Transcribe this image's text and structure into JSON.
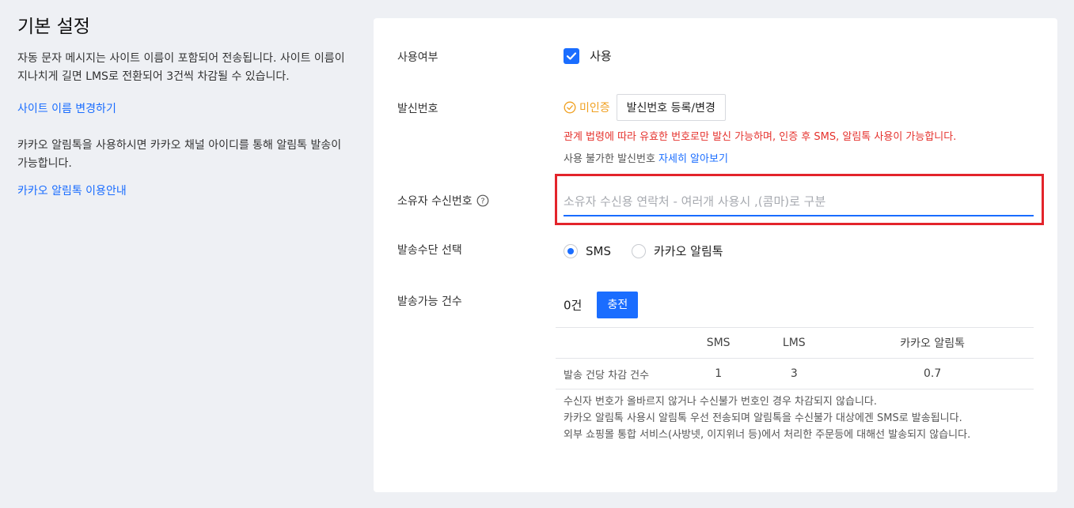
{
  "sidebar": {
    "title": "기본 설정",
    "description1": "자동 문자 메시지는 사이트 이름이 포함되어 전송됩니다. 사이트 이름이 지나치게 길면 LMS로 전환되어 3건씩 차감될 수 있습니다.",
    "link1": "사이트 이름 변경하기",
    "description2": "카카오 알림톡을 사용하시면 카카오 채널 아이디를 통해 알림톡 발송이 가능합니다.",
    "link2": "카카오 알림톡 이용안내"
  },
  "form": {
    "use": {
      "label": "사용여부",
      "checkbox_label": "사용",
      "checked": true
    },
    "sender": {
      "label": "발신번호",
      "status": "미인증",
      "register_button": "발신번호 등록/변경",
      "warning": "관계 법령에 따라 유효한 번호로만 발신 가능하며, 인증 후 SMS, 알림톡 사용이 가능합니다.",
      "note": "사용 불가한 발신번호",
      "note_link": "자세히 알아보기"
    },
    "owner_phone": {
      "label": "소유자 수신번호",
      "placeholder": "소유자 수신용 연락처 - 여러개 사용시 ,(콤마)로 구분",
      "value": ""
    },
    "method": {
      "label": "발송수단 선택",
      "options": [
        "SMS",
        "카카오 알림톡"
      ],
      "selected": "SMS"
    },
    "count": {
      "label": "발송가능 건수",
      "value": "0건",
      "charge_button": "충전"
    }
  },
  "rate_table": {
    "headers": [
      "",
      "SMS",
      "LMS",
      "카카오 알림톡"
    ],
    "rows": [
      {
        "label": "발송 건당 차감 건수",
        "sms": "1",
        "lms": "3",
        "kakao": "0.7"
      }
    ]
  },
  "footnotes": [
    "수신자 번호가 올바르지 않거나 수신불가 번호인 경우 차감되지 않습니다.",
    "카카오 알림톡 사용시 알림톡 우선 전송되며 알림톡을 수신불가 대상에겐 SMS로 발송됩니다.",
    "외부 쇼핑몰 통합 서비스(사방넷, 이지위너 등)에서 처리한 주문등에 대해선 발송되지 않습니다."
  ],
  "colors": {
    "accent": "#1a6dff",
    "warning": "#e5322d",
    "status": "#f0a020",
    "highlight": "#e3242b"
  }
}
